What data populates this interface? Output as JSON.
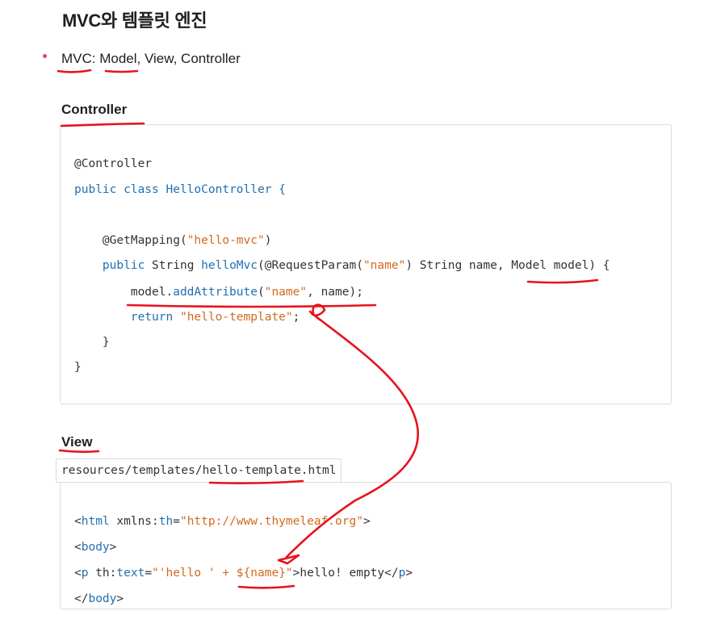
{
  "title": "MVC와 템플릿 엔진",
  "bullet": {
    "part1": "MVC",
    "sep1": ": ",
    "part2": "Model",
    "rest": ", View, Controller"
  },
  "controller_heading": "Controller",
  "controller_code": {
    "l1": "@Controller",
    "l2a": "public class",
    "l2b": " HelloController {",
    "l3a": "    @GetMapping(",
    "l3b": "\"hello-mvc\"",
    "l3c": ")",
    "l4a": "    ",
    "l4b": "public",
    "l4c": " String ",
    "l4d": "helloMvc",
    "l4e": "(@RequestParam(",
    "l4f": "\"name\"",
    "l4g": ") String name, Model model) {",
    "l5a": "        model.",
    "l5b": "addAttribute",
    "l5c": "(",
    "l5d": "\"name\"",
    "l5e": ", name);",
    "l6a": "        ",
    "l6b": "return",
    "l6c": " ",
    "l6d": "\"hello-template\"",
    "l6e": ";",
    "l7": "    }",
    "l8": "}"
  },
  "view_heading": "View",
  "view_path": "resources/templates/hello-template.html",
  "view_code": {
    "l1a": "<",
    "l1b": "html",
    "l1c": " xmlns:",
    "l1d": "th",
    "l1e": "=",
    "l1f": "\"http://www.thymeleaf.org\"",
    "l1g": ">",
    "l2a": "<",
    "l2b": "body",
    "l2c": ">",
    "l3a": "<",
    "l3b": "p",
    "l3c": " th:",
    "l3d": "text",
    "l3e": "=",
    "l3f": "\"'hello ' + ${name}\"",
    "l3g": ">hello! empty</",
    "l3h": "p",
    "l3i": ">",
    "l4a": "</",
    "l4b": "body",
    "l4c": ">"
  },
  "colors": {
    "keyword": "#1f6fb2",
    "string": "#d2691e",
    "annotation": "#e8121e",
    "bullet": "#e94560"
  }
}
